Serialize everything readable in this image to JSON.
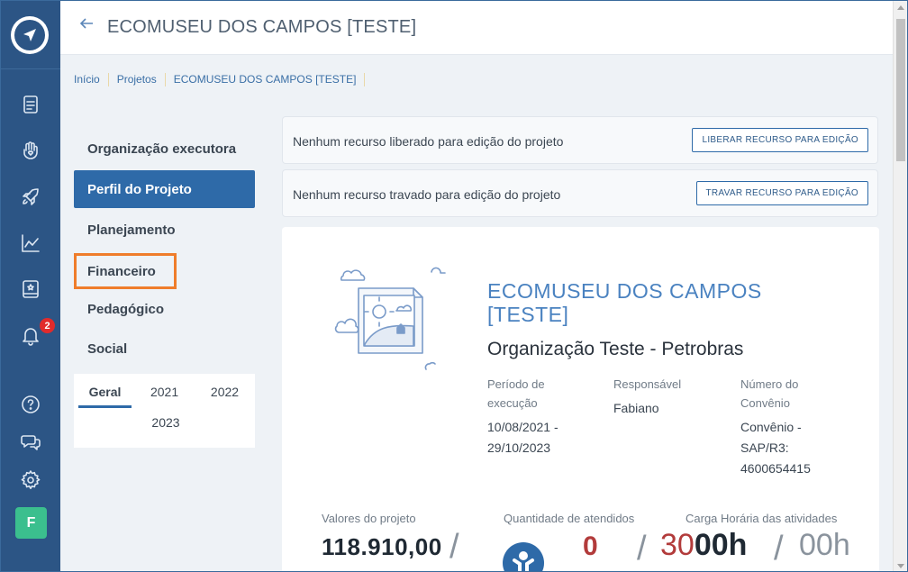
{
  "header": {
    "title": "ECOMUSEU DOS CAMPOS [TESTE]"
  },
  "breadcrumb": [
    "Início",
    "Projetos",
    "ECOMUSEU DOS CAMPOS [TESTE]"
  ],
  "sidebar": {
    "notifications_count": "2",
    "user_initial": "F",
    "icons": [
      "logo-icon",
      "document-icon",
      "hand-heart-icon",
      "rocket-icon",
      "chart-line-icon",
      "book-star-icon",
      "bell-icon",
      "help-icon",
      "chat-icon",
      "gear-icon"
    ]
  },
  "menu": {
    "items": [
      {
        "label": "Organização executora"
      },
      {
        "label": "Perfil do Projeto"
      },
      {
        "label": "Planejamento"
      },
      {
        "label": "Financeiro"
      },
      {
        "label": "Pedagógico"
      },
      {
        "label": "Social"
      }
    ],
    "active": "Perfil do Projeto",
    "highlighted": "Financeiro",
    "year_tabs": [
      "Geral",
      "2021",
      "2022",
      "2023"
    ],
    "active_year": "Geral"
  },
  "notices": [
    {
      "text": "Nenhum recurso liberado para edição do projeto",
      "button": "LIBERAR RECURSO PARA EDIÇÃO"
    },
    {
      "text": "Nenhum recurso travado para edição do projeto",
      "button": "TRAVAR RECURSO PARA EDIÇÃO"
    }
  ],
  "project": {
    "name": "ECOMUSEU DOS CAMPOS [TESTE]",
    "organization": "Organização Teste - Petrobras",
    "period_label": "Período de execução",
    "period_value": "10/08/2021 - 29/10/2023",
    "responsible_label": "Responsável",
    "responsible_value": "Fabiano",
    "agreement_label": "Número do Convênio",
    "agreement_value": "Convênio - SAP/R3: 4600654415"
  },
  "stats": {
    "values_label": "Valores do projeto",
    "values_amount": "118.910,00",
    "attendees_label": "Quantidade de atendidos",
    "attendees_value": "0",
    "hours_label": "Carga Horária das atividades",
    "hours_planned_prefix": "30",
    "hours_planned_bold": "00h",
    "hours_done": "00h"
  },
  "colors": {
    "sidebar": "#2c5585",
    "accent": "#2e6aa8",
    "highlight_outline": "#ef7d2b",
    "badge": "#e12b2b",
    "avatar": "#3bbf8e",
    "stat_red": "#b23b3b"
  }
}
